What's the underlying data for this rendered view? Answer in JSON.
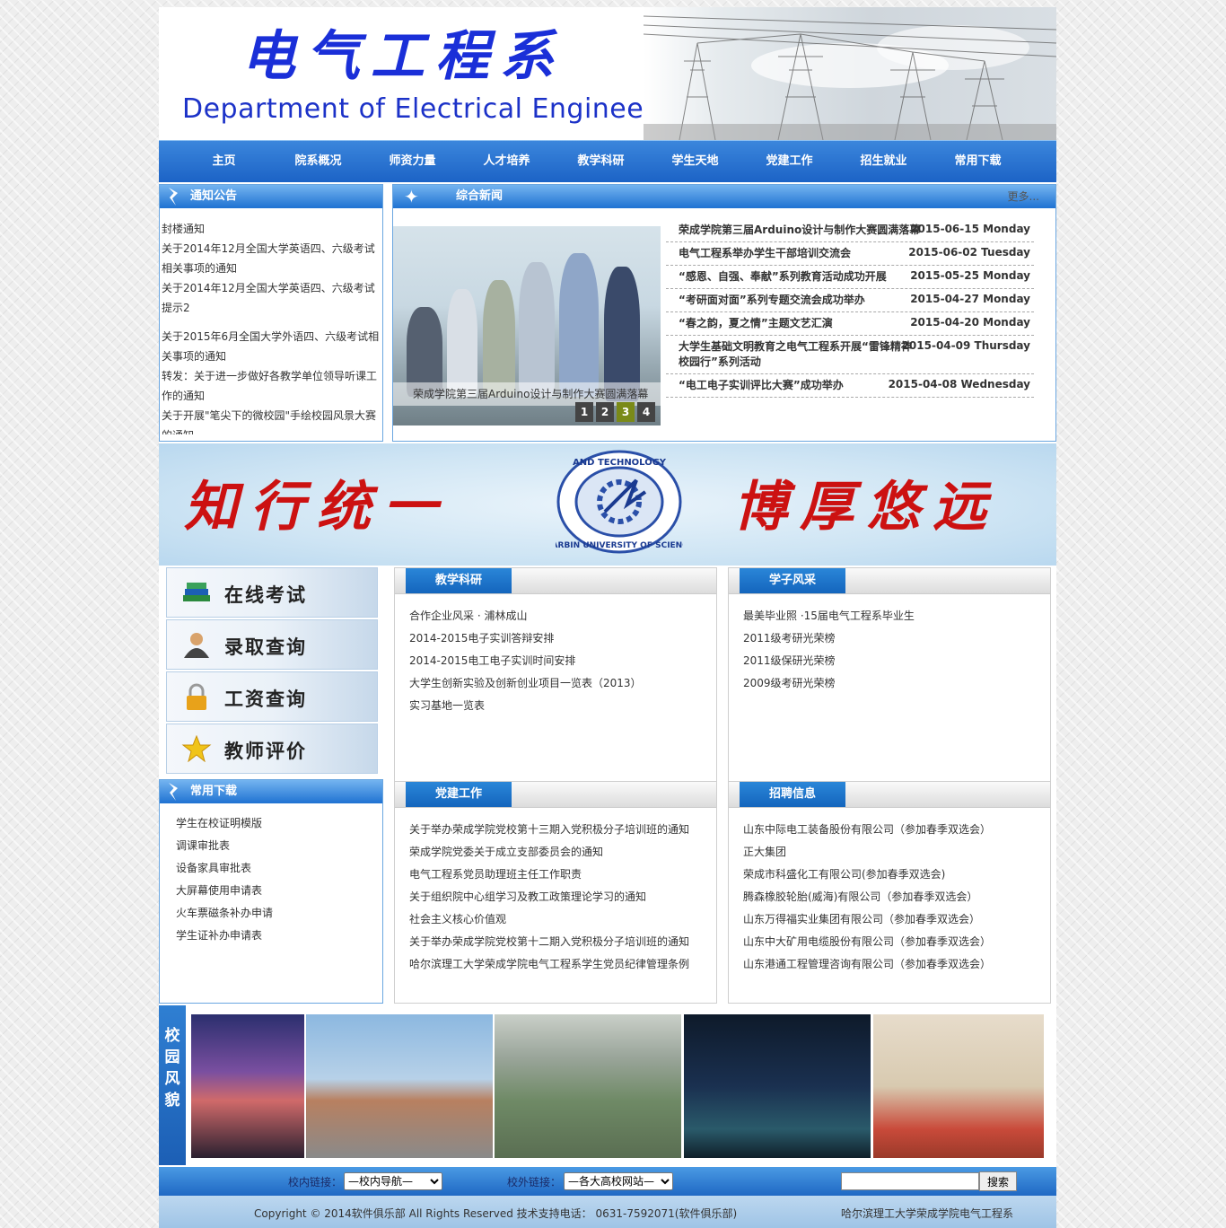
{
  "header": {
    "title_cn": "电气工程系",
    "title_en": "Department of Electrical Engineering"
  },
  "nav": [
    "主页",
    "院系概况",
    "师资力量",
    "人才培养",
    "教学科研",
    "学生天地",
    "党建工作",
    "招生就业",
    "常用下载"
  ],
  "notice": {
    "title": "通知公告",
    "items": [
      "封楼通知",
      "关于2014年12月全国大学英语四、六级考试相关事项的通知",
      "关于2014年12月全国大学英语四、六级考试提示2",
      "关于2015年6月全国大学外语四、六级考试相关事项的通知",
      "转发：关于进一步做好各教学单位领导听课工作的通知",
      "关于开展\"笔尖下的微校园\"手绘校园风景大赛的通知"
    ]
  },
  "news": {
    "title": "综合新闻",
    "more": "更多...",
    "slide_caption": "荣成学院第三届Arduino设计与制作大赛圆满落幕",
    "slide_pages": [
      "1",
      "2",
      "3",
      "4"
    ],
    "slide_active": 3,
    "items": [
      {
        "title": "荣成学院第三届Arduino设计与制作大赛圆满落幕",
        "date": "2015-06-15 Monday"
      },
      {
        "title": "电气工程系举办学生干部培训交流会",
        "date": "2015-06-02 Tuesday"
      },
      {
        "title": "“感恩、自强、奉献”系列教育活动成功开展",
        "date": "2015-05-25 Monday"
      },
      {
        "title": "“考研面对面”系列专题交流会成功举办",
        "date": "2015-04-27 Monday"
      },
      {
        "title": "“春之韵，夏之情”主题文艺汇演",
        "date": "2015-04-20 Monday"
      },
      {
        "title": "大学生基础文明教育之电气工程系开展“雷锋精神校园行”系列活动",
        "date": "2015-04-09 Thursday"
      },
      {
        "title": "“电工电子实训评比大赛”成功举办",
        "date": "2015-04-08 Wednesday"
      }
    ]
  },
  "banner": {
    "left": "知行统一",
    "right": "博厚悠远",
    "seal_top": "AND TECHNOLOGY",
    "seal_bottom": "HARBIN UNIVERSITY OF SCIENCE"
  },
  "quick": [
    "在线考试",
    "录取查询",
    "工资查询",
    "教师评价"
  ],
  "teaching": {
    "title": "教学科研",
    "items": [
      "合作企业风采 · 浦林成山",
      "2014-2015电子实训答辩安排",
      "2014-2015电工电子实训时间安排",
      "大学生创新实验及创新创业项目一览表（2013）",
      "实习基地一览表"
    ]
  },
  "students": {
    "title": "学子风采",
    "items": [
      "最美毕业照 ·15届电气工程系毕业生",
      "2011级考研光荣榜",
      "2011级保研光荣榜",
      "2009级考研光荣榜"
    ]
  },
  "downloads": {
    "title": "常用下载",
    "items": [
      "学生在校证明模版",
      "调课审批表",
      "设备家具审批表",
      "大屏幕使用申请表",
      "火车票磁条补办申请",
      "学生证补办申请表"
    ]
  },
  "party": {
    "title": "党建工作",
    "items": [
      "关于举办荣成学院党校第十三期入党积极分子培训班的通知",
      "荣成学院党委关于成立支部委员会的通知",
      "电气工程系党员助理班主任工作职责",
      "关于组织院中心组学习及教工政策理论学习的通知",
      "社会主义核心价值观",
      "关于举办荣成学院党校第十二期入党积极分子培训班的通知",
      "哈尔滨理工大学荣成学院电气工程系学生党员纪律管理条例"
    ]
  },
  "jobs": {
    "title": "招聘信息",
    "items": [
      "山东中际电工装备股份有限公司（参加春季双选会）",
      "正大集团",
      "荣成市科盛化工有限公司(参加春季双选会)",
      "腾森橡胶轮胎(威海)有限公司（参加春季双选会）",
      "山东万得福实业集团有限公司（参加春季双选会）",
      "山东中大矿用电缆股份有限公司（参加春季双选会）",
      "山东港通工程管理咨询有限公司（参加春季双选会）"
    ]
  },
  "campus": {
    "label": "校园风貌"
  },
  "footer": {
    "inner_label": "校内链接：",
    "inner_select": "—校内导航—",
    "outer_label": "校外链接：",
    "outer_select": "—各大高校网站—",
    "search_button": "搜索",
    "copyright": "Copyright © 2014软件俱乐部 All Rights Reserved 技术支持电话：  0631-7592071(软件俱乐部)",
    "org": "哈尔滨理工大学荣成学院电气工程系"
  },
  "colors": {
    "nav": "#1c63c6",
    "accent_red": "#cc1111",
    "title_blue": "#1a2fd8"
  }
}
